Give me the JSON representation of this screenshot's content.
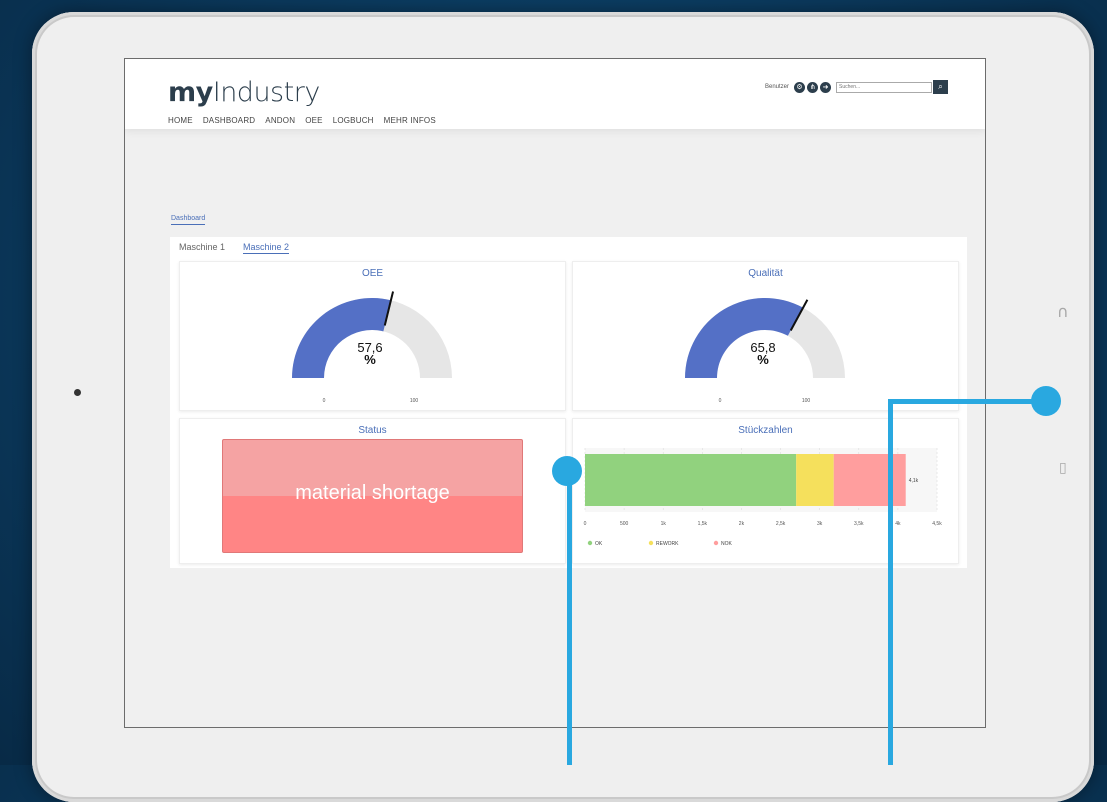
{
  "app": {
    "logo_bold": "my",
    "logo_light": "Industry",
    "nav": [
      "HOME",
      "DASHBOARD",
      "ANDON",
      "OEE",
      "LOGBUCH",
      "MEHR INFOS"
    ],
    "user_label": "Benutzer",
    "search_placeholder": "Suchen...",
    "icons": [
      "gear-icon",
      "sitemap-icon",
      "logout-icon",
      "search-icon"
    ]
  },
  "breadcrumb": "Dashboard",
  "tabs": [
    {
      "label": "Maschine 1",
      "active": false
    },
    {
      "label": "Maschine 2",
      "active": true
    }
  ],
  "oee": {
    "title": "OEE",
    "value_text": "57,6",
    "unit": "%",
    "value": 57.6,
    "min_label": "0",
    "max_label": "100",
    "color": "#5470c6"
  },
  "quality": {
    "title": "Qualität",
    "value_text": "65,8",
    "unit": "%",
    "value": 65.8,
    "min_label": "0",
    "max_label": "100",
    "color": "#5470c6"
  },
  "status": {
    "title": "Status",
    "text": "material shortage",
    "color": "#ff8585"
  },
  "chart_data": {
    "type": "bar",
    "orientation": "horizontal",
    "stacked": true,
    "title": "Stückzahlen",
    "xlim": [
      0,
      4500
    ],
    "ticks": [
      "0",
      "500",
      "1k",
      "1,5k",
      "2k",
      "2,5k",
      "3k",
      "3,5k",
      "4k",
      "4,5k"
    ],
    "tick_values": [
      0,
      500,
      1000,
      1500,
      2000,
      2500,
      3000,
      3500,
      4000,
      4500
    ],
    "series": [
      {
        "name": "OK",
        "value": 2700,
        "color": "#91d27e"
      },
      {
        "name": "REWORK",
        "value": 480,
        "color": "#f5e05c"
      },
      {
        "name": "NOK",
        "value": 920,
        "color": "#ff9e9e"
      }
    ],
    "total_label": "4,1k",
    "legend_position": "bottom-left",
    "grid": true
  }
}
